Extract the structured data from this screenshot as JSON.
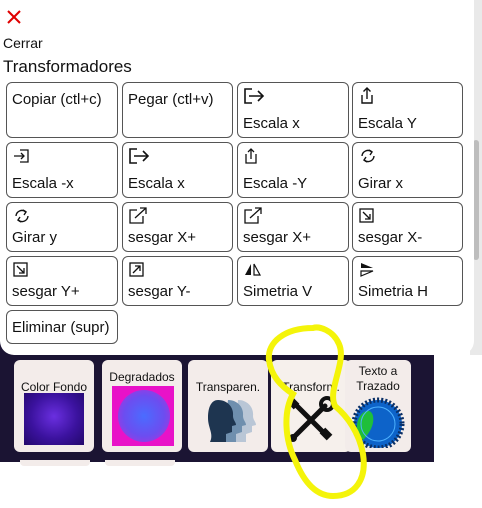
{
  "dialog": {
    "close_label": "Cerrar",
    "title": "Transformadores"
  },
  "buttons": [
    {
      "label": "Copiar (ctl+c)",
      "icon": ""
    },
    {
      "label": "Pegar (ctl+v)",
      "icon": ""
    },
    {
      "label": "Escala x",
      "icon": "arrow-right-from-box-icon"
    },
    {
      "label": "Escala Y",
      "icon": "arrow-up-from-box-icon"
    },
    {
      "label": "Escala -x",
      "icon": "arrow-into-box-icon"
    },
    {
      "label": "Escala x",
      "icon": "arrow-right-from-box-icon"
    },
    {
      "label": "Escala -Y",
      "icon": "arrow-up-into-box-icon"
    },
    {
      "label": "Girar x",
      "icon": "rotate-icon"
    },
    {
      "label": "Girar y",
      "icon": "rotate-icon"
    },
    {
      "label": "sesgar X+",
      "icon": "arrow-up-right-box-icon"
    },
    {
      "label": "sesgar X+",
      "icon": "arrow-up-right-box-icon"
    },
    {
      "label": "sesgar X-",
      "icon": "arrow-down-right-box-icon"
    },
    {
      "label": "sesgar Y+",
      "icon": "arrow-down-right-box-icon"
    },
    {
      "label": "sesgar Y-",
      "icon": "arrow-up-left-box-icon"
    },
    {
      "label": "Simetria V",
      "icon": "flip-vertical-icon"
    },
    {
      "label": "Simetria H",
      "icon": "flip-horizontal-icon"
    },
    {
      "label": "Eliminar (supr)",
      "icon": ""
    }
  ],
  "tools": [
    {
      "label": "Color Fondo"
    },
    {
      "label": "Degradados"
    },
    {
      "label": "Transparen."
    },
    {
      "label": "Transform."
    },
    {
      "label": "Texto a Trazado"
    }
  ],
  "colors": {
    "close": "#e00000",
    "highlight": "#f4f40a",
    "app_background": "#1b1433"
  }
}
